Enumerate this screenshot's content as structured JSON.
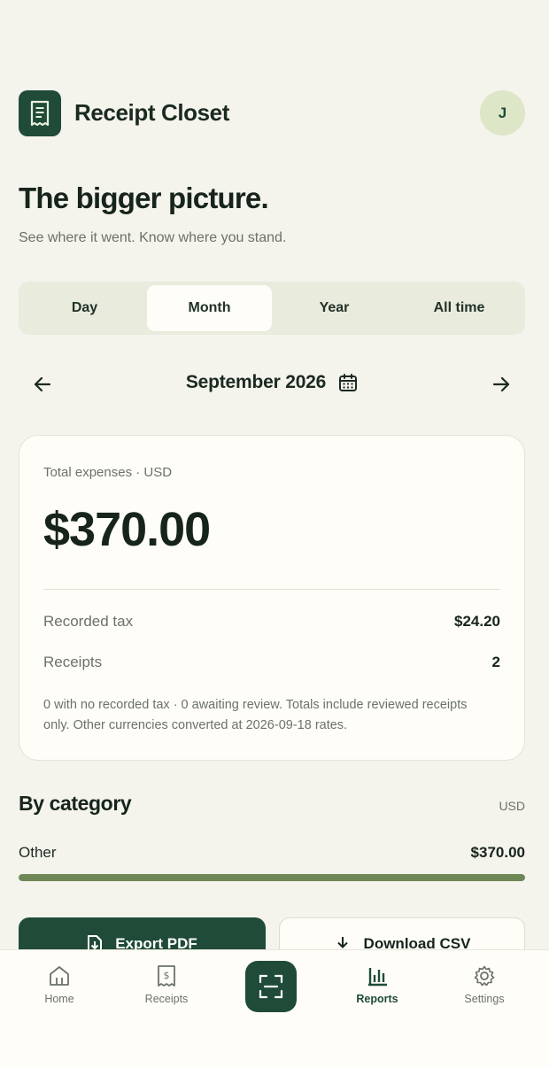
{
  "app": {
    "title": "Receipt Closet",
    "avatar_initial": "J"
  },
  "hero": {
    "headline": "The bigger picture.",
    "subheadline": "See where it went. Know where you stand."
  },
  "period_tabs": [
    {
      "label": "Day",
      "active": false
    },
    {
      "label": "Month",
      "active": true
    },
    {
      "label": "Year",
      "active": false
    },
    {
      "label": "All time",
      "active": false
    }
  ],
  "period": {
    "label": "September 2026",
    "prev_icon": "arrow-left-icon",
    "next_icon": "arrow-right-icon",
    "calendar_icon": "calendar-icon"
  },
  "summary": {
    "label": "Total expenses · USD",
    "total": "$370.00",
    "tax_label": "Recorded tax",
    "tax_value": "$24.20",
    "receipts_label": "Receipts",
    "receipts_value": "2",
    "note": "0 with no recorded tax · 0 awaiting review. Totals include reviewed receipts only. Other currencies converted at 2026-09-18 rates."
  },
  "category": {
    "title": "By category",
    "currency": "USD",
    "items": [
      {
        "name": "Other",
        "amount": "$370.00",
        "share": 1.0
      }
    ]
  },
  "actions": {
    "export_label": "Export PDF",
    "csv_label": "Download CSV"
  },
  "bottom_nav": {
    "items": [
      {
        "label": "Home",
        "icon": "home-icon",
        "active": false
      },
      {
        "label": "Receipts",
        "icon": "receipt-icon",
        "active": false
      },
      {
        "label": "Reports",
        "icon": "bar-chart-icon",
        "active": true
      },
      {
        "label": "Settings",
        "icon": "gear-icon",
        "active": false
      }
    ],
    "scan_icon": "scan-icon"
  },
  "colors": {
    "brand": "#1f4b38",
    "background": "#f4f3ec",
    "accent_bar": "#6d8757",
    "avatar_bg": "#dde6c6"
  }
}
